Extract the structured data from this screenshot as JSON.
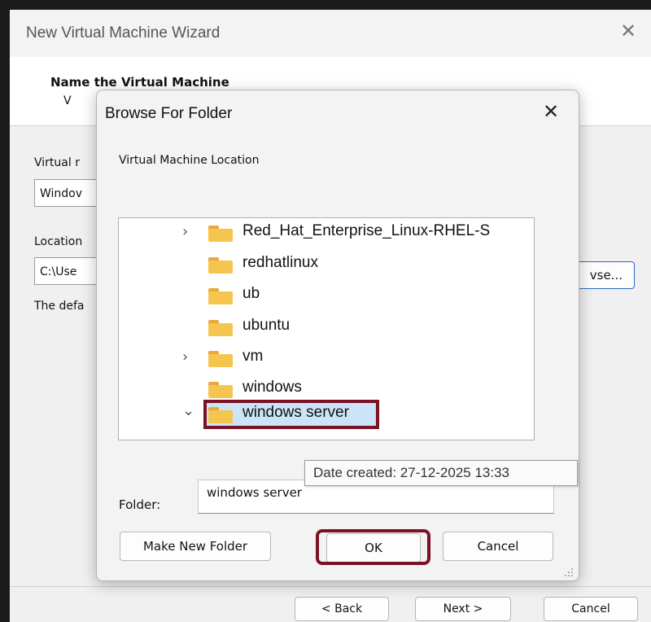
{
  "wizard": {
    "title": "New Virtual Machine Wizard",
    "heading": "Name the Virtual Machine",
    "subtext_partial": "V",
    "vm_name_label": "Virtual r",
    "vm_name_value": "Windov",
    "location_label": "Location",
    "location_value": "C:\\Use",
    "default_text": "The defa",
    "browse_label": "vse...",
    "back_label": "< Back",
    "next_label": "Next >",
    "cancel_label": "Cancel"
  },
  "dialog": {
    "title": "Browse For Folder",
    "description": "Virtual Machine Location",
    "tree_items": [
      {
        "label": "Red_Hat_Enterprise_Linux-RHEL-S",
        "expander": "›"
      },
      {
        "label": "redhatlinux",
        "expander": ""
      },
      {
        "label": "ub",
        "expander": ""
      },
      {
        "label": "ubuntu",
        "expander": ""
      },
      {
        "label": "vm",
        "expander": "›"
      },
      {
        "label": "windows",
        "expander": ""
      },
      {
        "label": "windows server",
        "expander": "⌄"
      }
    ],
    "selected_item": "windows server",
    "tooltip": "Date created: 27-12-2025 13:33",
    "folder_label": "Folder:",
    "folder_value": "windows server",
    "make_new_folder_label": "Make New Folder",
    "ok_label": "OK",
    "cancel_label": "Cancel"
  },
  "colors": {
    "highlight_border": "#7a1225",
    "selection_fill": "#cce4f7",
    "folder_yellow": "#f6c550"
  }
}
